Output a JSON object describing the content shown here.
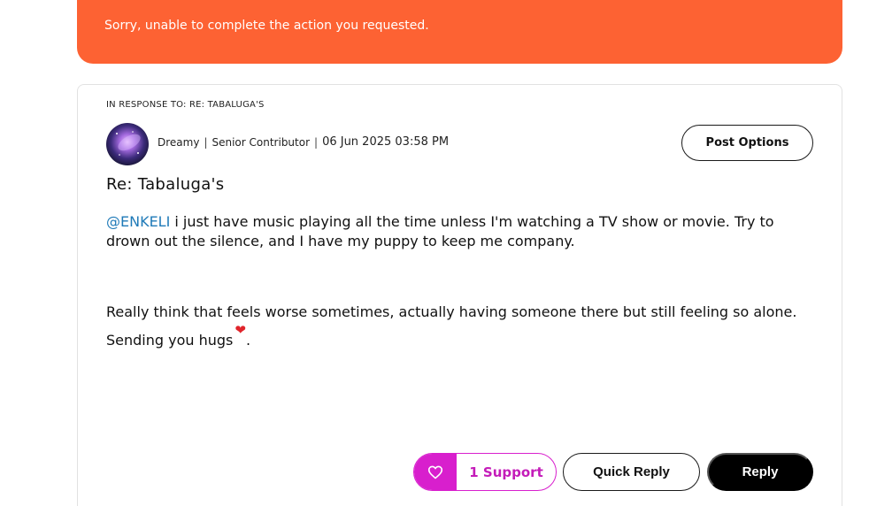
{
  "error_banner": {
    "message": "Sorry, unable to complete the action you requested.",
    "color": "#fd6233"
  },
  "post": {
    "in_response_to": "IN RESPONSE TO: RE: TABALUGA'S",
    "author": {
      "name": "Dreamy",
      "rank": "Senior Contributor",
      "avatar_icon": "galaxy-avatar"
    },
    "separator": "|",
    "date": "06 Jun 2025 03:58 PM",
    "post_options_label": "Post Options",
    "subject": "Re: Tabaluga's",
    "body": {
      "mention": "@ENKELI",
      "paragraph1": " i just have music playing all the time unless I'm watching a TV show or movie. Try to drown out the silence, and I have my puppy to keep me company.",
      "paragraph2": "Really think that feels worse sometimes, actually having someone there but still feeling so alone.",
      "paragraph3": "Sending you hugs",
      "heart": "❤",
      "paragraph3_end": "."
    },
    "actions": {
      "support_label": "1 Support",
      "support_icon": "heart-outline-icon",
      "support_color": "#d81fcd",
      "quick_reply_label": "Quick Reply",
      "reply_label": "Reply"
    }
  }
}
